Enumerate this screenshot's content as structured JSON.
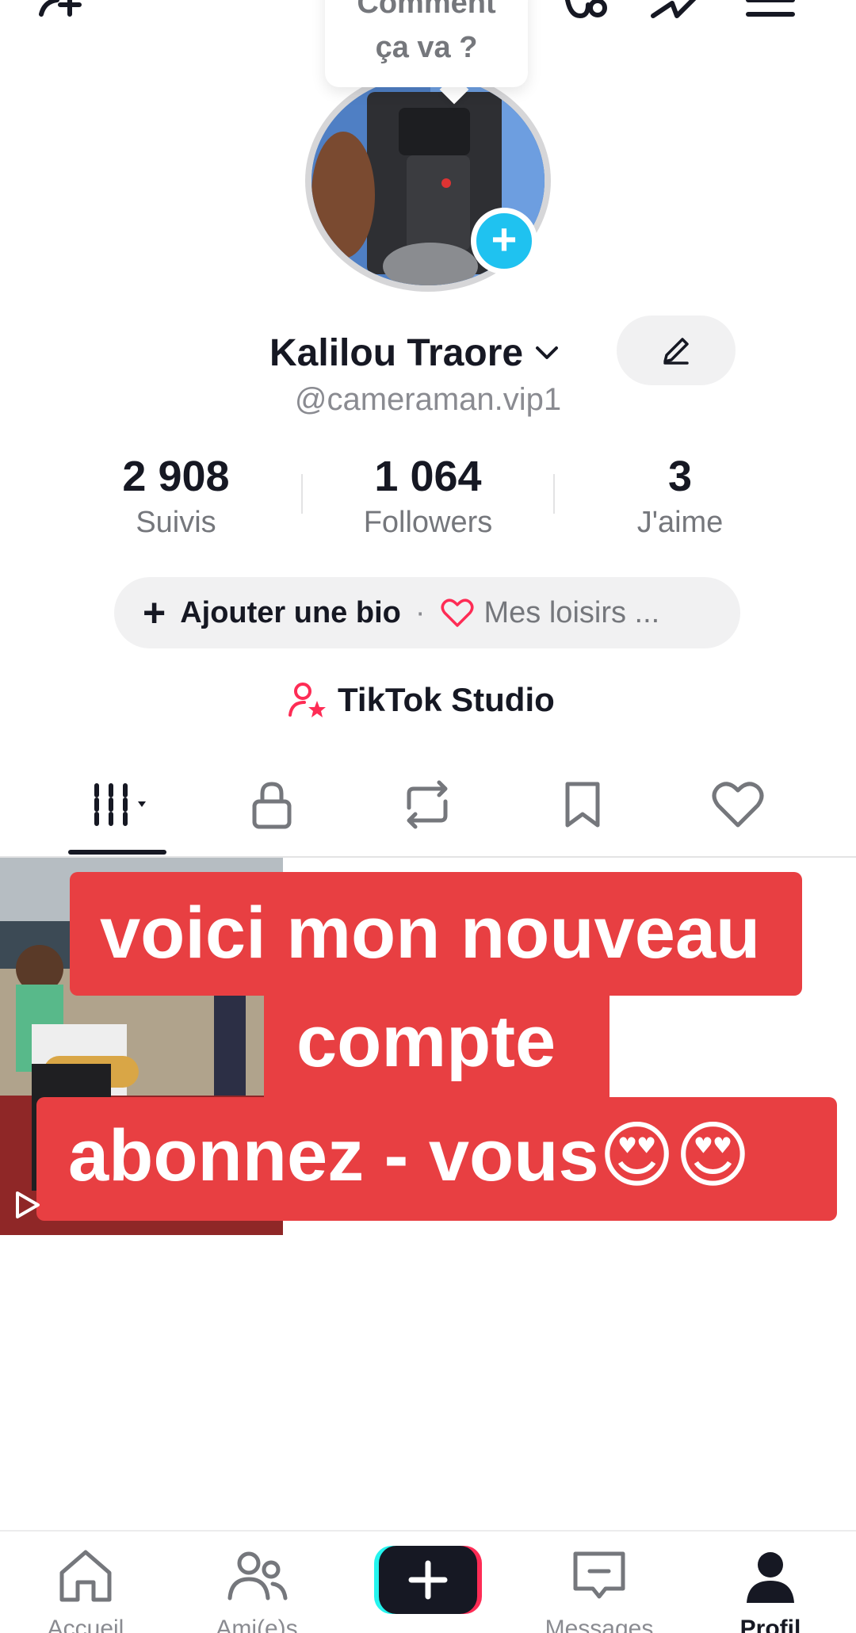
{
  "status_bubble": {
    "line1": "Comment",
    "line2": "ça va ?"
  },
  "profile": {
    "name": "Kalilou Traore",
    "handle": "@cameraman.vip1"
  },
  "stats": [
    {
      "value": "2 908",
      "label": "Suivis"
    },
    {
      "value": "1 064",
      "label": "Followers"
    },
    {
      "value": "3",
      "label": "J'aime"
    }
  ],
  "bio": {
    "add_label": "Ajouter une bio",
    "separator": "·",
    "hobbies_label": "Mes loisirs ..."
  },
  "studio": {
    "label": "TikTok Studio"
  },
  "tabs": [
    {
      "id": "videos",
      "icon": "grid-icon",
      "active": true
    },
    {
      "id": "private",
      "icon": "lock-icon"
    },
    {
      "id": "reposts",
      "icon": "repost-icon"
    },
    {
      "id": "favorites",
      "icon": "bookmark-icon"
    },
    {
      "id": "liked",
      "icon": "heart-icon"
    }
  ],
  "caption": {
    "line1": "voici mon nouveau",
    "line2": "compte",
    "line3": "abonnez - vous😍😍"
  },
  "nav": {
    "home": "Accueil",
    "friends": "Ami(e)s",
    "messages": "Messages",
    "profile": "Profil"
  },
  "colors": {
    "accent_blue": "#1fc2f0",
    "caption_red": "#e83f42",
    "heart_pink": "#fe2c55",
    "text_primary": "#161823",
    "text_secondary": "#75777c"
  }
}
